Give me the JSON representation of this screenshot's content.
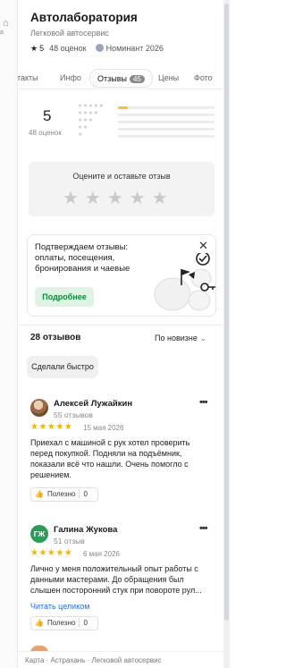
{
  "left_strip": {
    "label": "а"
  },
  "business": {
    "title": "Автолаборатория",
    "category": "Легковой автосервис",
    "rating": "5",
    "ratings_count": "48 оценок",
    "nominee": "Номинант 2026"
  },
  "tabs": [
    {
      "label": "нтакты"
    },
    {
      "label": "Инфо"
    },
    {
      "label": "Отзывы",
      "badge": "45",
      "active": true
    },
    {
      "label": "Цены"
    },
    {
      "label": "Фото"
    }
  ],
  "summary": {
    "score": "5",
    "ratings_count": "48 оценок",
    "histogram": [
      {
        "stars": 5,
        "fraction": 0.1
      },
      {
        "stars": 4,
        "fraction": 0
      },
      {
        "stars": 3,
        "fraction": 0
      },
      {
        "stars": 2,
        "fraction": 0
      },
      {
        "stars": 1,
        "fraction": 0
      }
    ]
  },
  "rate_box": {
    "label": "Оцените и оставьте отзыв"
  },
  "promo": {
    "text": "Подтверждаем отзывы: оплаты, посещения, бронирования и чаевые",
    "button": "Подробнее"
  },
  "reviews_header": {
    "count": "28 отзывов",
    "sort": "По новизне"
  },
  "filter_chip": "Сделали быстро",
  "reviews": [
    {
      "author": "Алексей Лужайкин",
      "author_reviews": "55 отзывов",
      "date": "15 мая 2026",
      "text": "Приехал с машиной с рук хотел проверить перед покупкой. Подняли на подъёмник, показали всё что нашли. Очень помогло с решением.",
      "helpful": "Полезно",
      "helpful_count": "0"
    },
    {
      "author": "Галина Жукова",
      "initials": "ГЖ",
      "author_reviews": "51 отзыв",
      "date": "6 мая 2026",
      "text": "Лично у меня положительный опыт работы с данными мастерами. До обращения был слышен посторонний стук при повороте рул...",
      "read_more": "Читать целиком",
      "helpful": "Полезно",
      "helpful_count": "0"
    }
  ],
  "footer": {
    "crumbs": [
      "Карта",
      "Астрахань",
      "Легковой автосервис"
    ],
    "separator": "·"
  },
  "colors": {
    "accent_star": "#f4b400",
    "promo_button_text": "#0d8a3c",
    "avatar_green": "#2e9a58"
  }
}
